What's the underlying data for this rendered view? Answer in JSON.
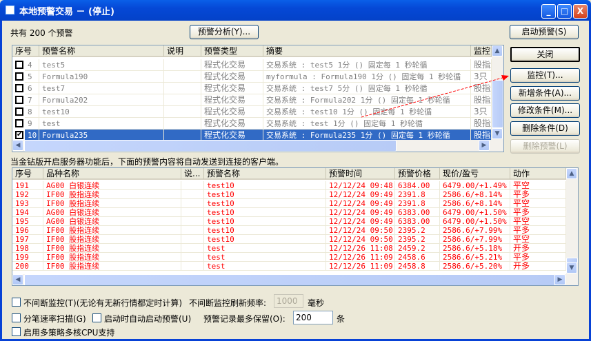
{
  "window": {
    "title": "本地预警交易 － (停止)",
    "minimize": "_",
    "maximize": "□",
    "close": "X"
  },
  "toolbar": {
    "count_text": "共有 200 个预警",
    "analysis_button": "预警分析(Y)...",
    "start_button": "启动预警(S)"
  },
  "alerts_table": {
    "columns": [
      "序号",
      "预警名称",
      "说明",
      "预警类型",
      "摘要",
      "监控"
    ],
    "rows": [
      {
        "checked": false,
        "id": "4",
        "name": "test5",
        "desc": "",
        "type": "程式化交易",
        "summary": "交易系统 : test5 1分 () 固定每 1 秒轮循",
        "monitor": "股指连续"
      },
      {
        "checked": false,
        "id": "5",
        "name": "Formula190",
        "desc": "",
        "type": "程式化交易",
        "summary": "myformula : Formula190 1分 () 固定每 1 秒轮循",
        "monitor": "3只"
      },
      {
        "checked": false,
        "id": "6",
        "name": "test7",
        "desc": "",
        "type": "程式化交易",
        "summary": "交易系统 : test7 5分 () 固定每 1 秒轮循",
        "monitor": "股指连续"
      },
      {
        "checked": false,
        "id": "7",
        "name": "Formula202",
        "desc": "",
        "type": "程式化交易",
        "summary": "交易系统 : Formula202 1分 () 固定每 1 秒轮循",
        "monitor": "股指连续"
      },
      {
        "checked": false,
        "id": "8",
        "name": "test10",
        "desc": "",
        "type": "程式化交易",
        "summary": "交易系统 : test10 1分 () 固定每 1 秒轮循",
        "monitor": "3只"
      },
      {
        "checked": false,
        "id": "9",
        "name": "test",
        "desc": "",
        "type": "程式化交易",
        "summary": "交易系统 : test 1分 () 固定每 1 秒轮循",
        "monitor": "股指连续"
      },
      {
        "checked": true,
        "id": "10",
        "name": "Formula235",
        "desc": "",
        "type": "程式化交易",
        "summary": "交易系统 : Formula235 1分 () 固定每 1 秒轮循",
        "monitor": "股指连续",
        "selected": true
      }
    ]
  },
  "side_buttons": {
    "close": "关闭",
    "monitor": "监控(T)...",
    "add": "新增条件(A)...",
    "edit": "修改条件(M)...",
    "delete_cond": "删除条件(D)",
    "delete_alert": "删除预警(L)"
  },
  "server_note": "当金钻版开启服务器功能后，下面的预警内容将自动发送到连接的客户端。",
  "records_table": {
    "columns": [
      "序号",
      "品种名称",
      "说...",
      "预警名称",
      "预警时间",
      "预警价格",
      "现价/盈亏",
      "动作"
    ],
    "rows": [
      [
        "191",
        "AG00 白银连续",
        "",
        "test10",
        "12/12/24 09:48",
        "6384.00",
        "6479.00/+1.49%",
        "平空"
      ],
      [
        "192",
        "IF00 股指连续",
        "",
        "test10",
        "12/12/24 09:49",
        "2391.8",
        "2586.6/+8.14%",
        "平多"
      ],
      [
        "193",
        "IF00 股指连续",
        "",
        "test10",
        "12/12/24 09:49",
        "2391.8",
        "2586.6/+8.14%",
        "平空"
      ],
      [
        "194",
        "AG00 白银连续",
        "",
        "test10",
        "12/12/24 09:49",
        "6383.00",
        "6479.00/+1.50%",
        "平多"
      ],
      [
        "195",
        "AG00 白银连续",
        "",
        "test10",
        "12/12/24 09:49",
        "6383.00",
        "6479.00/+1.50%",
        "平空"
      ],
      [
        "196",
        "IF00 股指连续",
        "",
        "test10",
        "12/12/24 09:50",
        "2395.2",
        "2586.6/+7.99%",
        "平多"
      ],
      [
        "197",
        "IF00 股指连续",
        "",
        "test10",
        "12/12/24 09:50",
        "2395.2",
        "2586.6/+7.99%",
        "平空"
      ],
      [
        "198",
        "IF00 股指连续",
        "",
        "test",
        "12/12/26 11:08",
        "2459.2",
        "2586.6/+5.18%",
        "开多"
      ],
      [
        "199",
        "IF00 股指连续",
        "",
        "test",
        "12/12/26 11:09",
        "2458.6",
        "2586.6/+5.21%",
        "平多"
      ],
      [
        "200",
        "IF00 股指连续",
        "",
        "test",
        "12/12/26 11:09",
        "2458.8",
        "2586.6/+5.20%",
        "开多"
      ]
    ]
  },
  "options": {
    "continuous_label": "不间断监控(T)(无论有无新行情都定时计算)",
    "continuous_checked": false,
    "refresh_label": "不间断监控刷新频率:",
    "refresh_value": "1000",
    "refresh_unit": "毫秒",
    "tick_scan_label": "分笔速率扫描(G)",
    "tick_scan_checked": false,
    "auto_start_label": "启动时自动启动预警(U)",
    "auto_start_checked": false,
    "keep_label": "预警记录最多保留(O):",
    "keep_value": "200",
    "keep_unit": "条",
    "multicore_label": "启用多策略多核CPU支持",
    "multicore_checked": false
  },
  "colors": {
    "title_bar": "#0548d6",
    "selection": "#316ac5",
    "record_text": "#ff0000",
    "annotation_arrow": "#ff0000"
  }
}
